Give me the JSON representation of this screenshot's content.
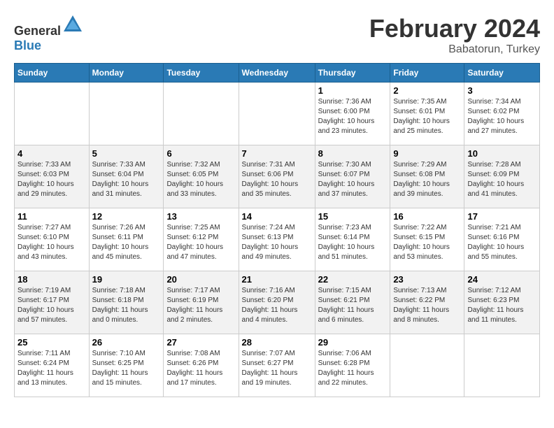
{
  "header": {
    "logo_general": "General",
    "logo_blue": "Blue",
    "title": "February 2024",
    "subtitle": "Babatorun, Turkey"
  },
  "calendar": {
    "days_of_week": [
      "Sunday",
      "Monday",
      "Tuesday",
      "Wednesday",
      "Thursday",
      "Friday",
      "Saturday"
    ],
    "weeks": [
      [
        {
          "day": "",
          "info": ""
        },
        {
          "day": "",
          "info": ""
        },
        {
          "day": "",
          "info": ""
        },
        {
          "day": "",
          "info": ""
        },
        {
          "day": "1",
          "info": "Sunrise: 7:36 AM\nSunset: 6:00 PM\nDaylight: 10 hours\nand 23 minutes."
        },
        {
          "day": "2",
          "info": "Sunrise: 7:35 AM\nSunset: 6:01 PM\nDaylight: 10 hours\nand 25 minutes."
        },
        {
          "day": "3",
          "info": "Sunrise: 7:34 AM\nSunset: 6:02 PM\nDaylight: 10 hours\nand 27 minutes."
        }
      ],
      [
        {
          "day": "4",
          "info": "Sunrise: 7:33 AM\nSunset: 6:03 PM\nDaylight: 10 hours\nand 29 minutes."
        },
        {
          "day": "5",
          "info": "Sunrise: 7:33 AM\nSunset: 6:04 PM\nDaylight: 10 hours\nand 31 minutes."
        },
        {
          "day": "6",
          "info": "Sunrise: 7:32 AM\nSunset: 6:05 PM\nDaylight: 10 hours\nand 33 minutes."
        },
        {
          "day": "7",
          "info": "Sunrise: 7:31 AM\nSunset: 6:06 PM\nDaylight: 10 hours\nand 35 minutes."
        },
        {
          "day": "8",
          "info": "Sunrise: 7:30 AM\nSunset: 6:07 PM\nDaylight: 10 hours\nand 37 minutes."
        },
        {
          "day": "9",
          "info": "Sunrise: 7:29 AM\nSunset: 6:08 PM\nDaylight: 10 hours\nand 39 minutes."
        },
        {
          "day": "10",
          "info": "Sunrise: 7:28 AM\nSunset: 6:09 PM\nDaylight: 10 hours\nand 41 minutes."
        }
      ],
      [
        {
          "day": "11",
          "info": "Sunrise: 7:27 AM\nSunset: 6:10 PM\nDaylight: 10 hours\nand 43 minutes."
        },
        {
          "day": "12",
          "info": "Sunrise: 7:26 AM\nSunset: 6:11 PM\nDaylight: 10 hours\nand 45 minutes."
        },
        {
          "day": "13",
          "info": "Sunrise: 7:25 AM\nSunset: 6:12 PM\nDaylight: 10 hours\nand 47 minutes."
        },
        {
          "day": "14",
          "info": "Sunrise: 7:24 AM\nSunset: 6:13 PM\nDaylight: 10 hours\nand 49 minutes."
        },
        {
          "day": "15",
          "info": "Sunrise: 7:23 AM\nSunset: 6:14 PM\nDaylight: 10 hours\nand 51 minutes."
        },
        {
          "day": "16",
          "info": "Sunrise: 7:22 AM\nSunset: 6:15 PM\nDaylight: 10 hours\nand 53 minutes."
        },
        {
          "day": "17",
          "info": "Sunrise: 7:21 AM\nSunset: 6:16 PM\nDaylight: 10 hours\nand 55 minutes."
        }
      ],
      [
        {
          "day": "18",
          "info": "Sunrise: 7:19 AM\nSunset: 6:17 PM\nDaylight: 10 hours\nand 57 minutes."
        },
        {
          "day": "19",
          "info": "Sunrise: 7:18 AM\nSunset: 6:18 PM\nDaylight: 11 hours\nand 0 minutes."
        },
        {
          "day": "20",
          "info": "Sunrise: 7:17 AM\nSunset: 6:19 PM\nDaylight: 11 hours\nand 2 minutes."
        },
        {
          "day": "21",
          "info": "Sunrise: 7:16 AM\nSunset: 6:20 PM\nDaylight: 11 hours\nand 4 minutes."
        },
        {
          "day": "22",
          "info": "Sunrise: 7:15 AM\nSunset: 6:21 PM\nDaylight: 11 hours\nand 6 minutes."
        },
        {
          "day": "23",
          "info": "Sunrise: 7:13 AM\nSunset: 6:22 PM\nDaylight: 11 hours\nand 8 minutes."
        },
        {
          "day": "24",
          "info": "Sunrise: 7:12 AM\nSunset: 6:23 PM\nDaylight: 11 hours\nand 11 minutes."
        }
      ],
      [
        {
          "day": "25",
          "info": "Sunrise: 7:11 AM\nSunset: 6:24 PM\nDaylight: 11 hours\nand 13 minutes."
        },
        {
          "day": "26",
          "info": "Sunrise: 7:10 AM\nSunset: 6:25 PM\nDaylight: 11 hours\nand 15 minutes."
        },
        {
          "day": "27",
          "info": "Sunrise: 7:08 AM\nSunset: 6:26 PM\nDaylight: 11 hours\nand 17 minutes."
        },
        {
          "day": "28",
          "info": "Sunrise: 7:07 AM\nSunset: 6:27 PM\nDaylight: 11 hours\nand 19 minutes."
        },
        {
          "day": "29",
          "info": "Sunrise: 7:06 AM\nSunset: 6:28 PM\nDaylight: 11 hours\nand 22 minutes."
        },
        {
          "day": "",
          "info": ""
        },
        {
          "day": "",
          "info": ""
        }
      ]
    ]
  }
}
